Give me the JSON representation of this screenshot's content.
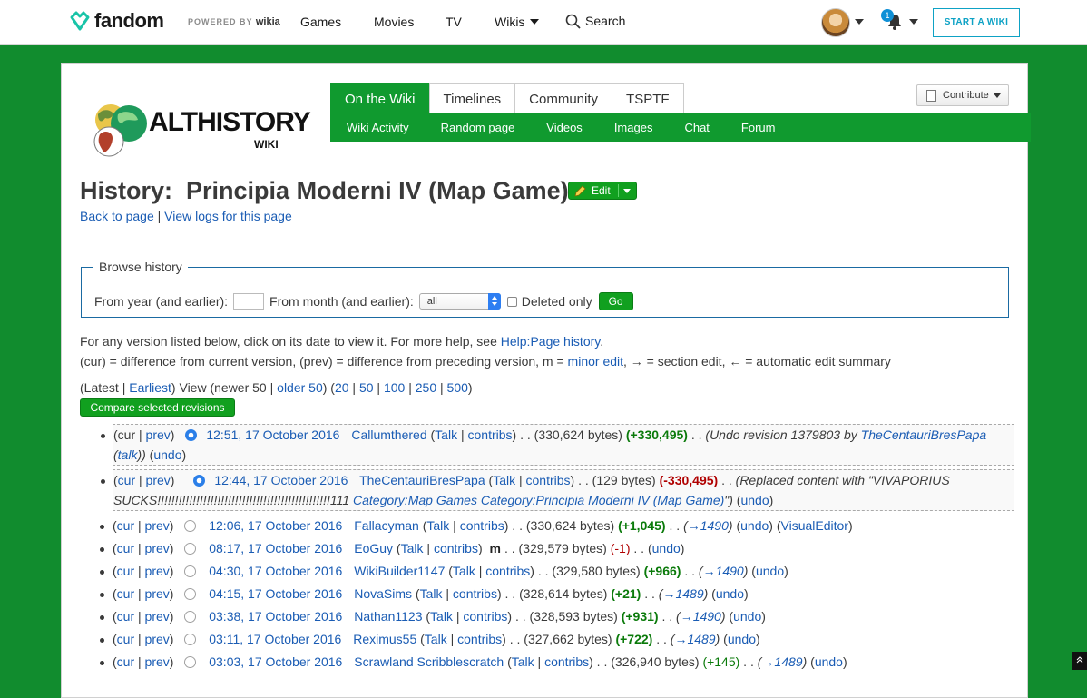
{
  "global_nav": {
    "brand": "fandom",
    "powered_by": "POWERED BY",
    "powered_by_brand": "wikia",
    "links": [
      "Games",
      "Movies",
      "TV",
      "Wikis"
    ],
    "search_placeholder": "Search",
    "notification_count": "1",
    "start_wiki": "START A WIKI"
  },
  "wiki": {
    "logo_title": "ALTHISTORY",
    "logo_sub": "WIKI",
    "tabs": [
      "On the Wiki",
      "Timelines",
      "Community",
      "TSPTF"
    ],
    "subnav": [
      "Wiki Activity",
      "Random page",
      "Videos",
      "Images",
      "Chat",
      "Forum"
    ],
    "contribute": "Contribute"
  },
  "page": {
    "title_prefix": "History:",
    "title": "Principia Moderni IV (Map Game)",
    "edit": "Edit",
    "back_to_page": "Back to page",
    "view_logs": "View logs for this page"
  },
  "browse": {
    "legend": "Browse history",
    "from_year": "From year (and earlier):",
    "from_month": "From month (and earlier):",
    "month_value": "all",
    "deleted_only": "Deleted only",
    "go": "Go"
  },
  "help": {
    "line1": "For any version listed below, click on its date to view it. For more help, see",
    "help_link": "Help:Page history",
    "line2a": "(cur) = difference from current version, (prev) = difference from preceding version, m =",
    "minor_edit": "minor edit",
    "line2b": ", → = section edit, ← = automatic edit summary"
  },
  "paging": {
    "latest": "Latest",
    "earliest": "Earliest",
    "view_newer": "View (newer 50",
    "older": "older 50",
    "limits": [
      "20",
      "50",
      "100",
      "250",
      "500"
    ]
  },
  "compare_button": "Compare selected revisions",
  "revisions": [
    {
      "date": "12:51, 17 October 2016",
      "user": "Callumthered",
      "bytes": "(330,624 bytes)",
      "diff": "(+330,495)",
      "summary": "(Undo revision 1379803 by",
      "summary_user": "TheCentauriBresPapa",
      "summary_talk": "talk"
    },
    {
      "date": "12:44, 17 October 2016",
      "user": "TheCentauriBresPapa",
      "bytes": "(129 bytes)",
      "diff": "(-330,495)",
      "summary": "(Replaced content with \"VIVAPORIUS SUCKS!!!!!!!!!!!!!!!!!!!!!!!!!!!!!!!!!!!!!!!!!!!!!!!!!111",
      "summary_link": "Category:Map Games Category:Principia Moderni IV (Map Game)",
      "summary_end": "\")"
    },
    {
      "date": "12:06, 17 October 2016",
      "user": "Fallacyman",
      "bytes": "(330,624 bytes)",
      "diff": "(+1,045)",
      "section": "→1490",
      "extra": "VisualEditor"
    },
    {
      "date": "08:17, 17 October 2016",
      "user": "EoGuy",
      "bytes": "(329,579 bytes)",
      "diff": "(-1)",
      "minor": "m"
    },
    {
      "date": "04:30, 17 October 2016",
      "user": "WikiBuilder1147",
      "bytes": "(329,580 bytes)",
      "diff": "(+966)",
      "section": "→1490"
    },
    {
      "date": "04:15, 17 October 2016",
      "user": "NovaSims",
      "bytes": "(328,614 bytes)",
      "diff": "(+21)",
      "section": "→1489"
    },
    {
      "date": "03:38, 17 October 2016",
      "user": "Nathan1123",
      "bytes": "(328,593 bytes)",
      "diff": "(+931)",
      "section": "→1490"
    },
    {
      "date": "03:11, 17 October 2016",
      "user": "Reximus55",
      "bytes": "(327,662 bytes)",
      "diff": "(+722)",
      "section": "→1489"
    },
    {
      "date": "03:03, 17 October 2016",
      "user": "Scrawland Scribblescratch",
      "bytes": "(326,940 bytes)",
      "diff": "(+145)",
      "section": "→1489"
    }
  ],
  "common": {
    "cur": "cur",
    "prev": "prev",
    "talk": "Talk",
    "contribs": "contribs",
    "undo": "undo"
  },
  "colors": {
    "fandom_green": "#118c2e",
    "tab_green": "#109a2f",
    "link": "#1a5cb4",
    "start_wiki": "#0ea2c5"
  }
}
